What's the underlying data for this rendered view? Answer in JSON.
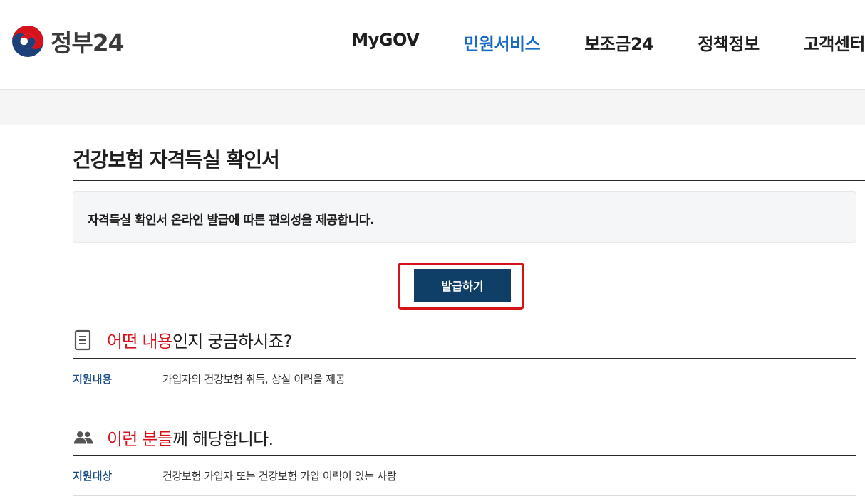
{
  "header": {
    "logo_text": "정부24",
    "nav": [
      {
        "label": "MyGOV"
      },
      {
        "label": "민원서비스"
      },
      {
        "label": "보조금24"
      },
      {
        "label": "정책정보"
      },
      {
        "label": "고객센터"
      }
    ],
    "active_nav": "민원서비스"
  },
  "page": {
    "title": "건강보험 자격득실 확인서",
    "description": "자격득실 확인서 온라인 발급에 따른 편의성을 제공합니다.",
    "issue_button": "발급하기"
  },
  "sections": [
    {
      "icon": "document-icon",
      "title_highlight": "어떤 내용",
      "title_rest": "인지 궁금하시죠?",
      "rows": [
        {
          "label": "지원내용",
          "value": "가입자의 건강보험 취득, 상실 이력을 제공"
        }
      ]
    },
    {
      "icon": "people-icon",
      "title_highlight": "이런 분들",
      "title_rest": "께 해당합니다.",
      "rows": [
        {
          "label": "지원대상",
          "value": "건강보험 가입자 또는 건강보험 가입 이력이 있는 사람"
        }
      ]
    }
  ],
  "colors": {
    "accent_red": "#d6121b",
    "nav_active": "#1769c4",
    "button_navy": "#0f3f66",
    "label_blue": "#1b4f8a"
  }
}
